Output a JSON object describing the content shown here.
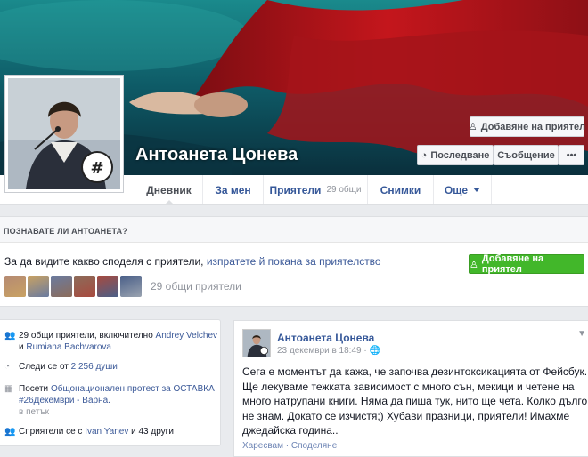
{
  "profile": {
    "name": "Антоанета Цонева"
  },
  "cover_actions": {
    "add_friend": "Добавяне на приятел",
    "follow": "Последване",
    "message": "Съобщение",
    "more": "•••"
  },
  "nav": {
    "tabs": [
      {
        "label": "Дневник"
      },
      {
        "label": "За мен"
      },
      {
        "label": "Приятели",
        "sub": "29 общи"
      },
      {
        "label": "Снимки"
      },
      {
        "label": "Още"
      }
    ]
  },
  "know": {
    "heading": "ПОЗНАВАТЕ ЛИ АНТОАНЕТА?",
    "text_before": "За да видите какво споделя с приятели, ",
    "text_link": "изпратете й покана за приятелство",
    "add_button": "Добавяне на приятел",
    "mutual": "29 общи приятели",
    "thumb_colors": [
      "#b58a73",
      "#c9a263",
      "#6a7ba0",
      "#8c6c5a",
      "#a84a3f",
      "#4a5f88",
      "#9aa3b0"
    ]
  },
  "intro": {
    "mutual_text": "29 общи приятели, включително ",
    "mutual_name1": "Andrey Velchev",
    "mutual_and": " и ",
    "mutual_name2": "Rumiana Bachvarova",
    "followers_text": "Следи се от ",
    "followers_count": "2 256 души",
    "event_text": "Посети ",
    "event_link": "Общонационален протест за ОСТАВКА #26Декември - Варна.",
    "event_time": "в петък",
    "related_text": "Сприятели се с ",
    "related_name": "Ivan Yanev",
    "related_rest": " и 43 други"
  },
  "post": {
    "author": "Антоанета Цонева",
    "time": "23 декември в 18:49 · ",
    "text": "Сега е моментът да кажа, че започва дезинтоксикацията от Фейсбук. Ще лекуваме тежката зависимост с много сън, мекици и четене на много натрупани книги. Няма да пиша тук, нито ще чета. Колко дълго не знам. Докато се изчистя;) Хубави празници, приятели! Имахме джедайска година..",
    "like": "Харесвам",
    "sep": " · ",
    "share": "Споделяне"
  },
  "colors": {
    "brand": "#3b5998",
    "green": "#42b72a"
  }
}
